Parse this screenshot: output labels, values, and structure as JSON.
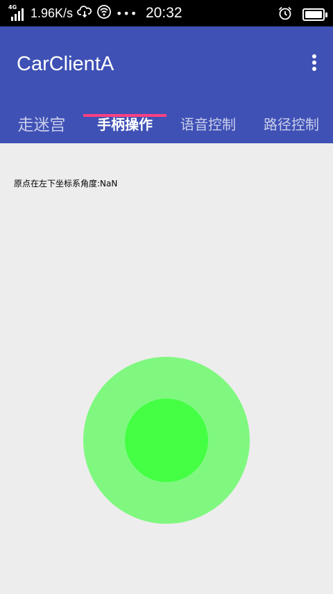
{
  "status_bar": {
    "network": "4G",
    "net_speed": "1.96K/s",
    "more": "•••",
    "time": "20:32",
    "icons": [
      "signal-icon",
      "cloud-sync-icon",
      "wifi-hotspot-icon",
      "alarm-icon",
      "battery-icon"
    ]
  },
  "app_bar": {
    "title": "CarClientA",
    "menu_icon": "overflow-menu-icon",
    "color": "#3f51b5"
  },
  "tabs": {
    "items": [
      {
        "label": "走迷宫"
      },
      {
        "label": "手柄操作"
      },
      {
        "label": "语音控制"
      },
      {
        "label": "路径控制"
      }
    ],
    "selected": "手柄操作",
    "indicator_color": "#ff4081"
  },
  "content": {
    "angle_label": "原点在左下坐标系角度:NaN"
  },
  "joystick": {
    "outer_color": "#80f880",
    "inner_color": "#44ff44"
  }
}
